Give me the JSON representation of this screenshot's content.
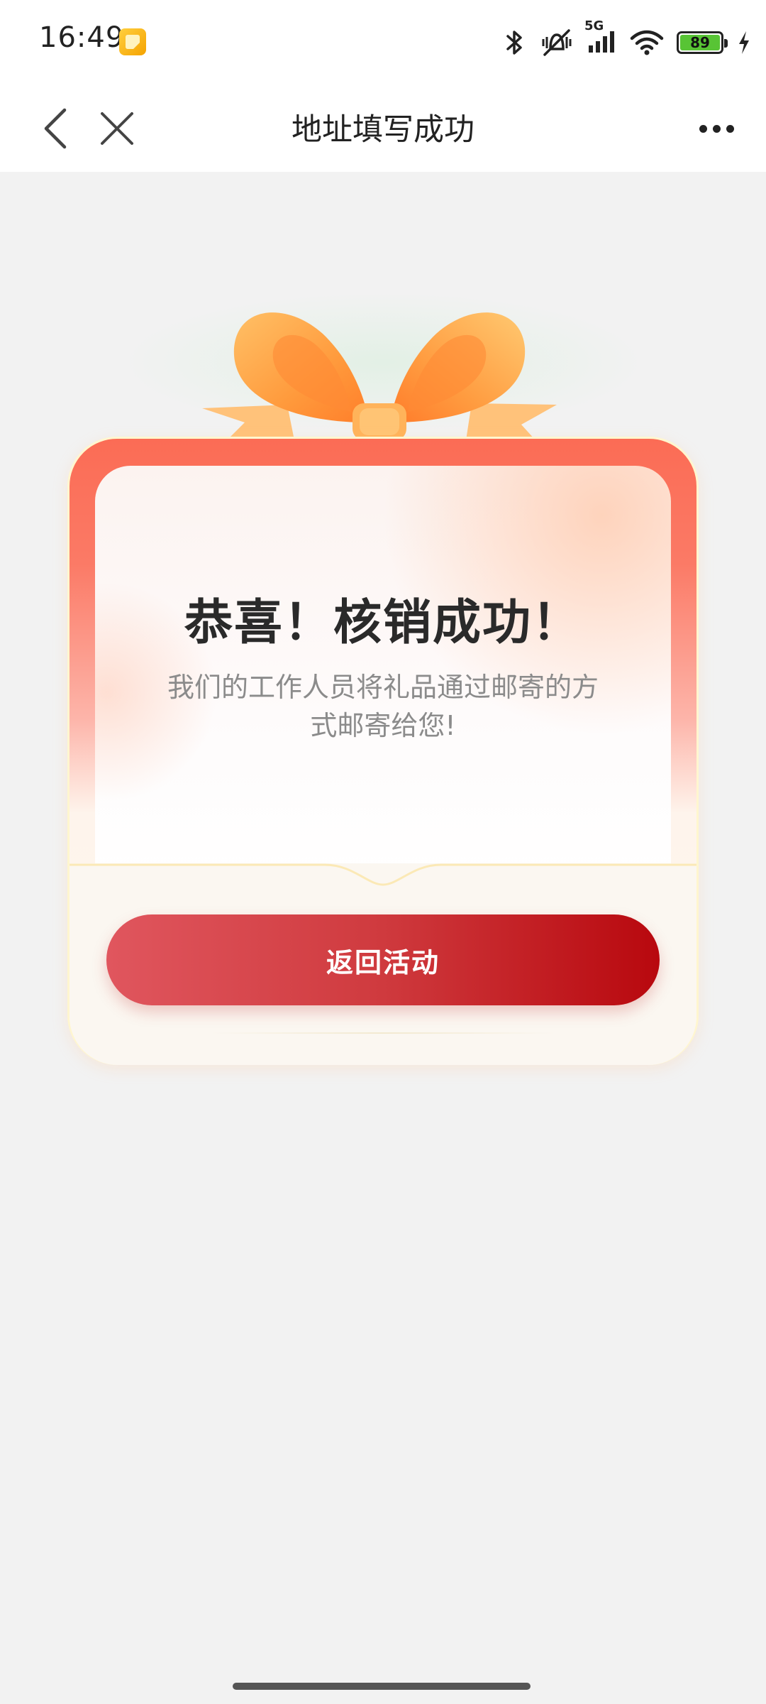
{
  "status_bar": {
    "time": "16:49",
    "network_label": "5G",
    "battery_level": "89",
    "icons": [
      "app-notification-icon",
      "bluetooth-icon",
      "vibrate-off-icon",
      "cellular-signal-icon",
      "wifi-icon",
      "battery-icon",
      "charging-icon"
    ]
  },
  "nav": {
    "title": "地址填写成功",
    "icons": [
      "back-icon",
      "close-icon",
      "more-icon"
    ]
  },
  "card": {
    "title": "恭喜！核销成功！",
    "description": "我们的工作人员将礼品通过邮寄的方式邮寄给您!",
    "button_label": "返回活动",
    "colors": {
      "ribbon": "#ffa24a",
      "card_top": "#fb6c55",
      "button_start": "#e0565e",
      "button_end": "#b8080e"
    }
  }
}
